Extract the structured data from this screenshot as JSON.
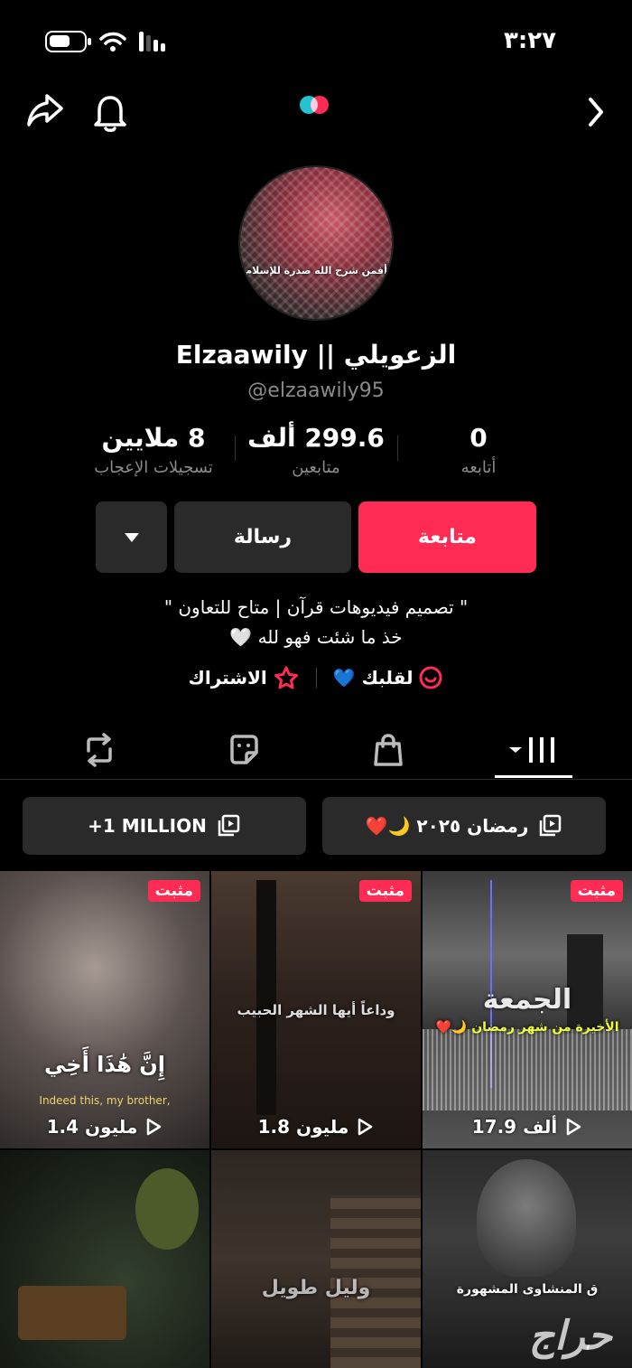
{
  "status_bar": {
    "time": "٣:٢٧"
  },
  "profile": {
    "display_name": "Elzaawily || الزعويلي",
    "username": "@elzaawily95",
    "avatar_caption": "أفمن شرح الله صدرة للإسلام"
  },
  "stats": {
    "following": {
      "value": "0",
      "label": "أتابعه"
    },
    "followers": {
      "value": "299.6 ألف",
      "label": "متابعين"
    },
    "likes": {
      "value": "8 ملايين",
      "label": "تسجيلات الإعجاب"
    }
  },
  "actions": {
    "follow_label": "متابعة",
    "message_label": "رسالة"
  },
  "bio": {
    "line1": "\" تصميم فيديوهات قرآن | متاح للتعاون \"",
    "line2": "خذ ما شئت فهو لله 🤍",
    "link1": "لقلبك 💙",
    "link2": "الاشتراك"
  },
  "tabs": [
    {
      "name": "videos",
      "icon": "grid-icon",
      "active": true
    },
    {
      "name": "shop",
      "icon": "shopping-bag-icon",
      "active": false
    },
    {
      "name": "stickers",
      "icon": "sticker-icon",
      "active": false
    },
    {
      "name": "reposts",
      "icon": "repost-icon",
      "active": false
    }
  ],
  "playlists": [
    {
      "label": "رمضان ٢٠٢٥ 🌙❤️"
    },
    {
      "label": "+1 MILLION"
    }
  ],
  "videos": [
    {
      "pinned_label": "مثبت",
      "views": "17.9 ألف",
      "title": "الجمعة",
      "subtitle": "الأخيرة من شهر رمضان 🌙❤️"
    },
    {
      "pinned_label": "مثبت",
      "views": "1.8 مليون",
      "title": "وداعاً أيها الشهر الحبيب"
    },
    {
      "pinned_label": "مثبت",
      "views": "1.4 مليون",
      "title": "إِنَّ هَٰذَا أَخِي",
      "subtitle": "Indeed this, my brother,"
    },
    {
      "title": "ق المنشاوى المشهورة"
    },
    {
      "title": "وليل طويل"
    },
    {
      "title": ""
    }
  ],
  "watermark": "حراج",
  "colors": {
    "accent": "#fe2c55",
    "background": "#000000",
    "button_dark": "#2a2a2a"
  }
}
